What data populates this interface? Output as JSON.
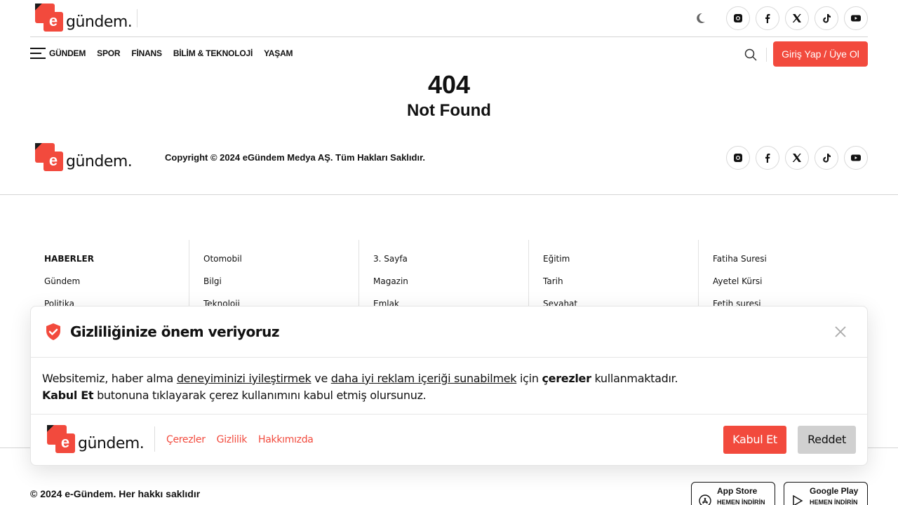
{
  "brand": {
    "name": "gündem.",
    "letter": "e",
    "accent": "#f24a3d"
  },
  "header": {
    "social_icons": [
      "instagram-icon",
      "facebook-icon",
      "x-icon",
      "tiktok-icon",
      "youtube-icon"
    ],
    "theme_icon": "moon-icon"
  },
  "nav": {
    "items": [
      "GÜNDEM",
      "SPOR",
      "FİNANS",
      "BİLİM & TEKNOLOJİ",
      "YAŞAM"
    ],
    "login_label": "Giriş Yap / Üye Ol"
  },
  "error": {
    "code": "404",
    "message": "Not Found"
  },
  "footer_top": {
    "copyright": "Copyright © 2024 eGündem Medya AŞ. Tüm Hakları Saklıdır."
  },
  "columns": [
    [
      "HABERLER",
      "Gündem",
      "Politika"
    ],
    [
      "Otomobil",
      "Bilgi",
      "Teknoloji"
    ],
    [
      "3. Sayfa",
      "Magazin",
      "Emlak"
    ],
    [
      "Eğitim",
      "Tarih",
      "Seyahat"
    ],
    [
      "Fatiha Suresi",
      "Ayetel Kürsi",
      "Fetih suresi"
    ]
  ],
  "footer_bottom": {
    "copyright": "© 2024 e-Gündem. Her hakkı saklıdır",
    "app_store": {
      "title": "App Store",
      "sub": "HEMEN İNDİRİN"
    },
    "google_play": {
      "title": "Google Play",
      "sub": "HEMEN İNDİRİN"
    }
  },
  "cookie": {
    "title": "Gizliliğinize önem veriyoruz",
    "text_1": "Websitemiz, haber alma ",
    "link_1": "deneyiminizi iyileştirmek",
    "text_2": " ve ",
    "link_2": "daha iyi reklam içeriği sunabilmek",
    "text_3": " için ",
    "bold_1": "çerezler",
    "text_4": " kullanmaktadır.",
    "bold_2": "Kabul Et",
    "text_5": " butonuna tıklayarak çerez kullanımını kabul etmiş olursunuz.",
    "links": [
      "Çerezler",
      "Gizlilik",
      "Hakkımızda"
    ],
    "accept_label": "Kabul Et",
    "reject_label": "Reddet"
  }
}
